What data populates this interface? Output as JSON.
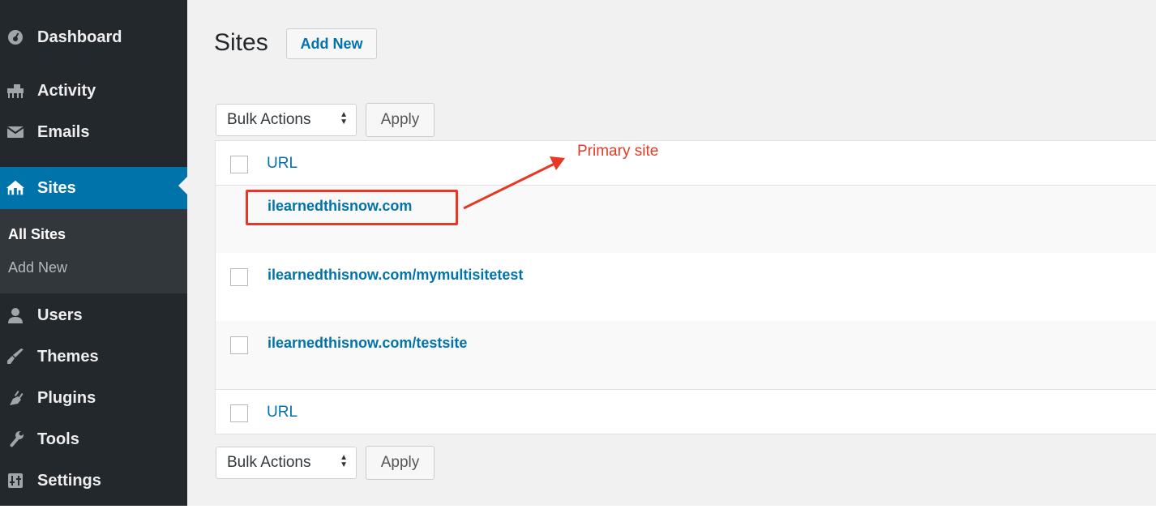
{
  "sidebar": {
    "items": [
      {
        "label": "Dashboard",
        "icon": "dashboard-icon"
      },
      {
        "label": "Activity",
        "icon": "activity-icon"
      },
      {
        "label": "Emails",
        "icon": "envelope-icon"
      },
      {
        "label": "Sites",
        "icon": "sites-icon"
      },
      {
        "label": "Users",
        "icon": "user-icon"
      },
      {
        "label": "Themes",
        "icon": "brush-icon"
      },
      {
        "label": "Plugins",
        "icon": "plugin-icon"
      },
      {
        "label": "Tools",
        "icon": "wrench-icon"
      },
      {
        "label": "Settings",
        "icon": "settings-icon"
      }
    ],
    "submenu": [
      "All Sites",
      "Add New"
    ]
  },
  "page": {
    "title": "Sites",
    "add_new": "Add New"
  },
  "bulk": {
    "label": "Bulk Actions",
    "apply": "Apply"
  },
  "table": {
    "header": "URL",
    "footer": "URL",
    "rows": [
      "ilearnedthisnow.com",
      "ilearnedthisnow.com/mymultisitetest",
      "ilearnedthisnow.com/testsite"
    ]
  },
  "annotation": {
    "text": "Primary site",
    "color": "#e53925"
  },
  "colors": {
    "sidebar_bg": "#23282d",
    "active_bg": "#0073aa",
    "link": "#0073aa"
  }
}
